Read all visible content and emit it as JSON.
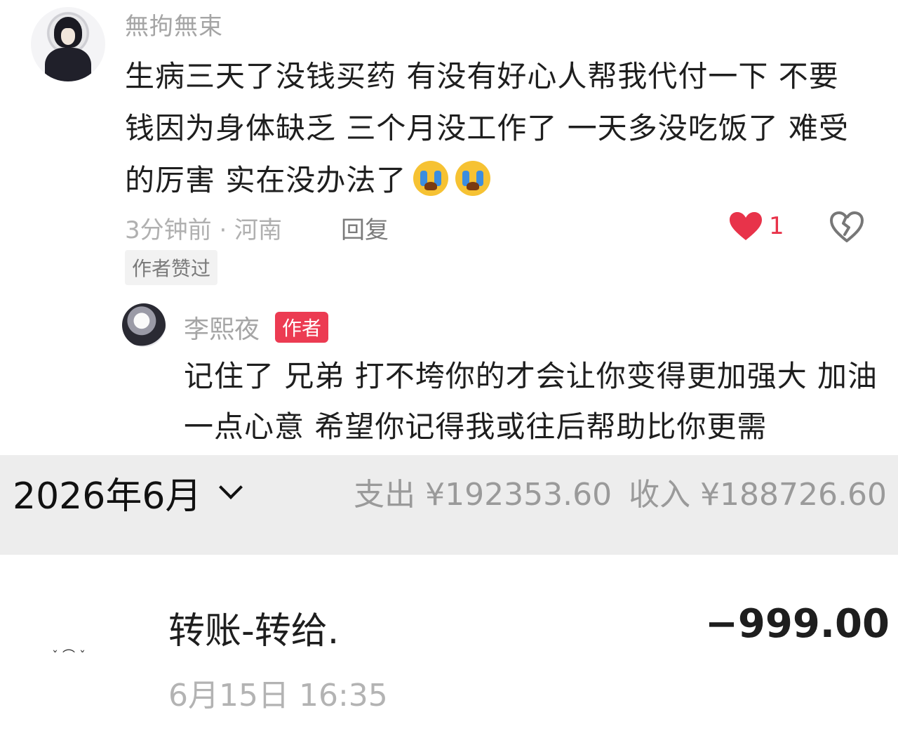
{
  "comment": {
    "username": "無拘無束",
    "text": "生病三天了没钱买药 有没有好心人帮我代付一下 不要钱因为身体缺乏 三个月没工作了 一天多没吃饭了 难受的厉害 实在没办法了",
    "emoji_icons": [
      "crying-face-icon",
      "crying-face-icon"
    ],
    "meta": "3分钟前 · 河南",
    "reply_label": "回复",
    "like_count": "1",
    "author_liked_label": "作者赞过"
  },
  "reply": {
    "username": "李熙夜",
    "badge": "作者",
    "text": "记住了 兄弟 打不垮你的才会让你变得更加强大 加油一点心意 希望你记得我或往后帮助比你更需"
  },
  "ledger": {
    "month": "2026年6月",
    "expense": "支出 ¥192353.60",
    "income": "收入 ¥188726.60"
  },
  "transaction": {
    "title": "转账-转给.",
    "amount": "−999.00",
    "time": "6月15日 16:35"
  },
  "colors": {
    "like_red": "#e8334a",
    "author_badge": "#ec3b52",
    "header_bg": "#ededed"
  }
}
